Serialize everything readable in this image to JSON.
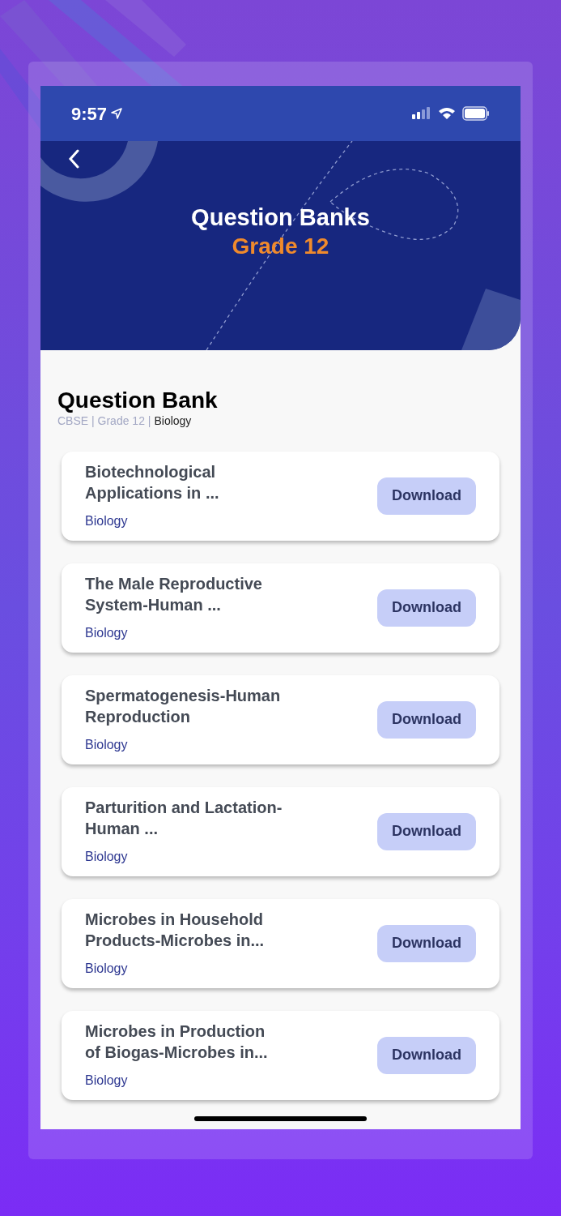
{
  "status_bar": {
    "time": "9:57"
  },
  "header": {
    "title": "Question Banks",
    "subtitle": "Grade 12"
  },
  "section": {
    "title": "Question Bank",
    "breadcrumb": {
      "path": "CBSE | Grade 12 |",
      "current": "Biology"
    }
  },
  "items": [
    {
      "title": "Biotechnological Applications in ...",
      "subject": "Biology",
      "button": "Download"
    },
    {
      "title": "The Male Reproductive System-Human ...",
      "subject": "Biology",
      "button": "Download"
    },
    {
      "title": "Spermatogenesis-Human Reproduction",
      "subject": "Biology",
      "button": "Download"
    },
    {
      "title": "Parturition and Lactation-Human ...",
      "subject": "Biology",
      "button": "Download"
    },
    {
      "title": "Microbes in Household Products-Microbes in...",
      "subject": "Biology",
      "button": "Download"
    },
    {
      "title": "Microbes in Production of Biogas-Microbes in...",
      "subject": "Biology",
      "button": "Download"
    }
  ]
}
